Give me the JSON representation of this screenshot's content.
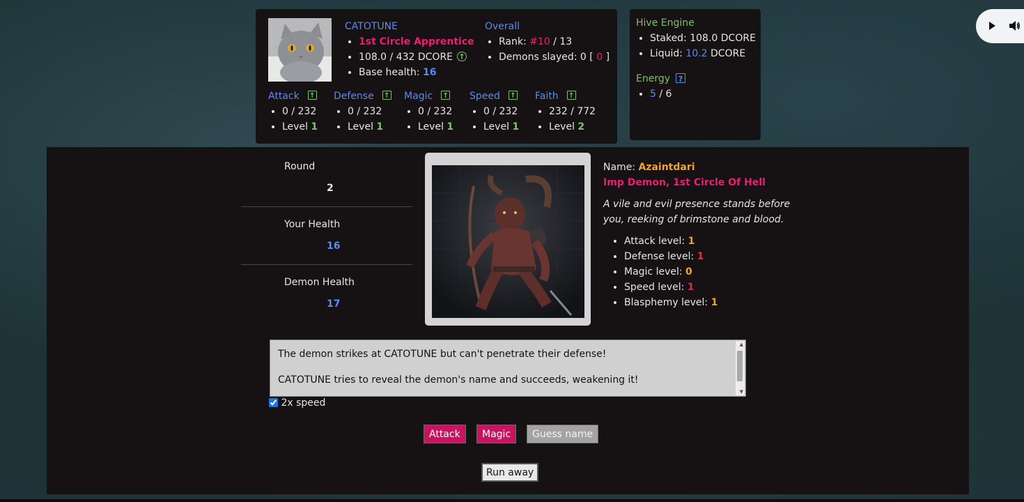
{
  "player": {
    "name": "CATOTUNE",
    "rank_title": "1st Circle Apprentice",
    "dcore_progress": "108.0 / 432 DCORE",
    "base_health_label": "Base health: ",
    "base_health": "16"
  },
  "overall": {
    "title": "Overall",
    "rank_label": "Rank: ",
    "rank": "#10",
    "rank_total": " / 13",
    "demons_label": "Demons slayed: 0 [ ",
    "demons_count": "0",
    "demons_end": " ]"
  },
  "stats": [
    {
      "name": "Attack",
      "progress": "0 / 232",
      "level_label": "Level ",
      "level": "1"
    },
    {
      "name": "Defense",
      "progress": "0 / 232",
      "level_label": "Level ",
      "level": "1"
    },
    {
      "name": "Magic",
      "progress": "0 / 232",
      "level_label": "Level ",
      "level": "1"
    },
    {
      "name": "Speed",
      "progress": "0 / 232",
      "level_label": "Level ",
      "level": "1"
    },
    {
      "name": "Faith",
      "progress": "232 / 772",
      "level_label": "Level ",
      "level": "2"
    }
  ],
  "hive": {
    "title": "Hive Engine",
    "staked_label": "Staked: 108.0 DCORE",
    "liquid_label": "Liquid: ",
    "liquid_value": "10.2",
    "liquid_unit": " DCORE",
    "energy_title": "Energy",
    "energy_value": "5",
    "energy_max": " / 6"
  },
  "battle": {
    "round_label": "Round",
    "round": "2",
    "your_health_label": "Your Health",
    "your_health": "16",
    "demon_health_label": "Demon Health",
    "demon_health": "17"
  },
  "demon": {
    "name_label": "Name: ",
    "name": "Azaintdari",
    "type": "Imp Demon, 1st Circle Of Hell",
    "description": "A vile and evil presence stands before you, reeking of brimstone and blood.",
    "stats": [
      {
        "label": "Attack level: ",
        "value": "1",
        "color": "#f0a331"
      },
      {
        "label": "Defense level: ",
        "value": "1",
        "color": "#e8284a"
      },
      {
        "label": "Magic level: ",
        "value": "0",
        "color": "#f0a331"
      },
      {
        "label": "Speed level: ",
        "value": "1",
        "color": "#e8284a"
      },
      {
        "label": "Blasphemy level: ",
        "value": "1",
        "color": "#f0a331"
      }
    ]
  },
  "log": [
    "The demon strikes at CATOTUNE but can't penetrate their defense!",
    "CATOTUNE tries to reveal the demon's name and succeeds, weakening it!"
  ],
  "controls": {
    "speed_label": "2x speed",
    "speed_checked": true,
    "attack": "Attack",
    "magic": "Magic",
    "guess": "Guess name",
    "run": "Run away"
  },
  "colors": {
    "accent_blue": "#5b8bf0",
    "accent_green": "#7cc26a",
    "accent_pink": "#ea1f72",
    "button_red": "#c8145e",
    "panel_bg": "#161112"
  },
  "icons": [
    "arrow-up-circle-icon",
    "arrow-up-square-icon",
    "question-icon",
    "play-icon",
    "volume-icon"
  ]
}
